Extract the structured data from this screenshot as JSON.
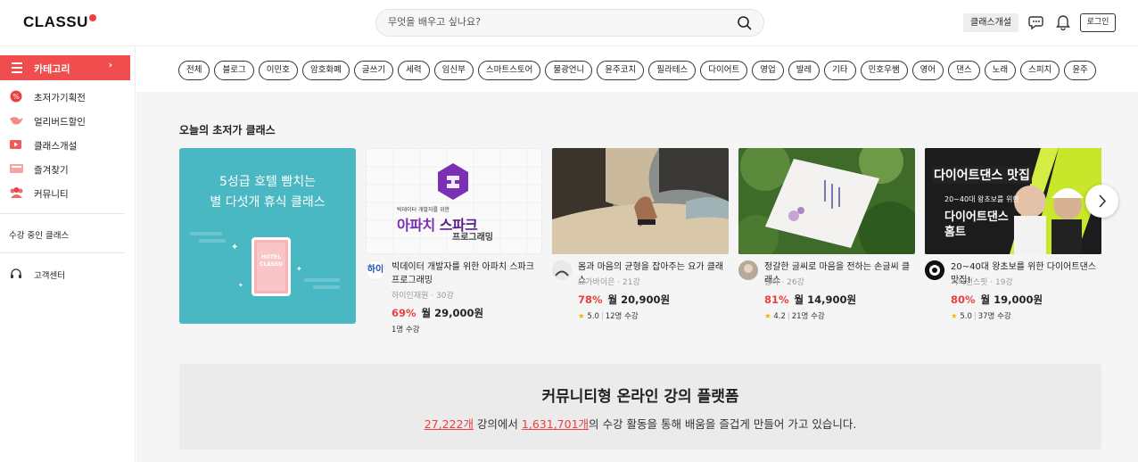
{
  "header": {
    "logo": "CLASSU",
    "search_placeholder": "무엇을 배우고 싶나요?",
    "create_class": "클래스개설",
    "login": "로그인"
  },
  "sidebar": {
    "category": "카테고리",
    "items": [
      {
        "label": "초저가기획전",
        "icon": "sale-badge-icon"
      },
      {
        "label": "얼리버드할인",
        "icon": "bird-icon"
      },
      {
        "label": "클래스개설",
        "icon": "class-open-icon"
      },
      {
        "label": "즐겨찾기",
        "icon": "bookmark-icon"
      },
      {
        "label": "커뮤니티",
        "icon": "community-icon"
      }
    ],
    "in_progress": "수강 중인 클래스",
    "support": "고객센터"
  },
  "chips": [
    "전체",
    "블로그",
    "이민호",
    "암호화폐",
    "글쓰기",
    "세력",
    "임신부",
    "스마트스토어",
    "물광언니",
    "윤주코치",
    "필라테스",
    "다이어트",
    "영업",
    "발레",
    "기타",
    "민호우쌤",
    "영어",
    "댄스",
    "노래",
    "스피치",
    "윤주"
  ],
  "section_title": "오늘의 초저가 클래스",
  "promo": {
    "line1": "5성급 호텔 빰치는",
    "line2": "별 다섯개 휴식 클래스",
    "card_text": "HOTEL CLASSU"
  },
  "courses": [
    {
      "thumb_top": "빅데이터 개발자를 위한",
      "thumb_main1": "아파치 ",
      "thumb_main2": "스파크",
      "thumb_sub": "프로그래밍",
      "avatar_text": "하이",
      "title": "빅데이터 개발자를 위한 아파치 스파크 프로그래밍",
      "author": "하이인재원",
      "lectures": "30강",
      "discount": "69%",
      "price": "월 29,000원",
      "students": "1명 수강"
    },
    {
      "title": "몸과 마음의 균형을 잡아주는 요가 클래스",
      "author": "요가바이은",
      "lectures": "21강",
      "discount": "78%",
      "price": "월 20,900원",
      "rating": "5.0",
      "students": "12명 수강"
    },
    {
      "title": "정갈한 글씨로 마음을 전하는 손글씨 클래스",
      "author": "송하",
      "lectures": "26강",
      "discount": "81%",
      "price": "월 14,900원",
      "rating": "4.2",
      "students": "21명 수강"
    },
    {
      "thumb_title": "다이어트댄스 맛집",
      "thumb_sub": "20~40대 왕초보를 위한",
      "thumb_big1": "다이어트댄스",
      "thumb_big2": "홈트",
      "title": "20~40대 왕초보를 위한 다이어트댄스 맛집!",
      "author": "지니댄스핏",
      "lectures": "19강",
      "discount": "80%",
      "price": "월 19,000원",
      "rating": "5.0",
      "students": "37명 수강"
    }
  ],
  "banner": {
    "heading": "커뮤니티형 온라인 강의 플랫폼",
    "count1": "27,222개",
    "mid1": " 강의에서 ",
    "count2": "1,631,701개",
    "mid2": "의 수강 활동을 통해 배움을 즐겁게 만들어 가고 있습니다."
  },
  "colors": {
    "accent": "#f04e4e",
    "discount": "#e8413f",
    "promo_bg": "#4ab8c2",
    "star": "#f2b705"
  }
}
